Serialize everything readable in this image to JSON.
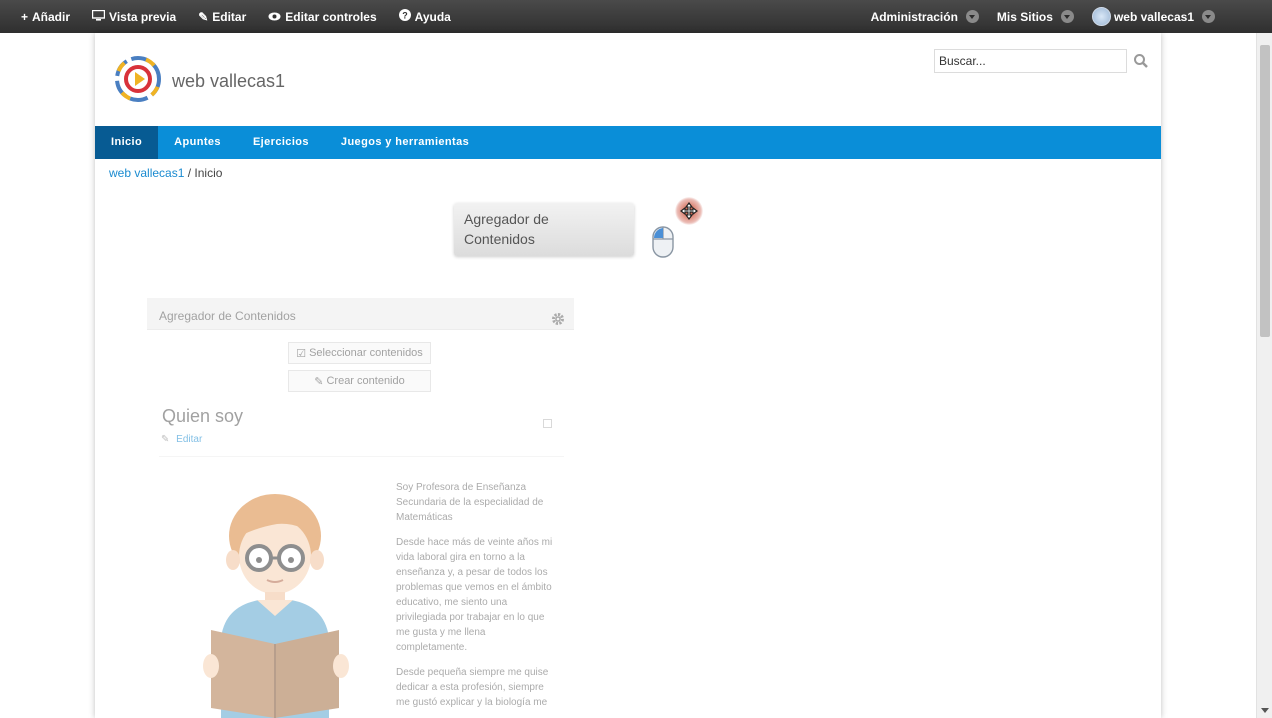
{
  "dockbar": {
    "left": [
      {
        "icon": "plus-icon",
        "glyph": "+",
        "label": "Añadir"
      },
      {
        "icon": "monitor-icon",
        "glyph": "🖵",
        "label": "Vista previa"
      },
      {
        "icon": "edit-icon",
        "glyph": "✎",
        "label": "Editar"
      },
      {
        "icon": "eye-icon",
        "glyph": "👁",
        "label": "Editar controles"
      },
      {
        "icon": "help-icon",
        "glyph": "?",
        "label": "Ayuda"
      }
    ],
    "admin_label": "Administración",
    "sites_label": "Mis Sitios",
    "user_label": "web vallecas1"
  },
  "header": {
    "site_name": "web vallecas1",
    "search_placeholder": "Buscar..."
  },
  "nav": {
    "items": [
      "Inicio",
      "Apuntes",
      "Ejercicios",
      "Juegos y herramientas"
    ]
  },
  "breadcrumb": {
    "root": "web vallecas1",
    "separator": " / ",
    "current": "Inicio"
  },
  "drag_tile": {
    "line1": "Agregador de",
    "line2": "Contenidos"
  },
  "portlet": {
    "title": "Agregador de Contenidos",
    "select_button": "Seleccionar contenidos",
    "create_button": "Crear contenido",
    "article_title": "Quien soy",
    "edit_link": "Editar",
    "bio_p1": "Soy Profesora de Enseñanza Secundaria de la especialidad de Matemáticas",
    "bio_p2": "Desde hace más de veinte años mi vida laboral gira en torno a la enseñanza y, a pesar de todos los problemas que vemos en el ámbito educativo, me siento una privilegiada por trabajar en lo que me gusta y me llena completamente.",
    "bio_p3": "Desde pequeña siempre me quise dedicar a esta profesión, siempre me gustó explicar y la biología me"
  },
  "colors": {
    "dockbar": "#2f2f2f",
    "navbar": "#0a8ed8",
    "nav_active": "#075b93",
    "link": "#1b8bd0"
  }
}
